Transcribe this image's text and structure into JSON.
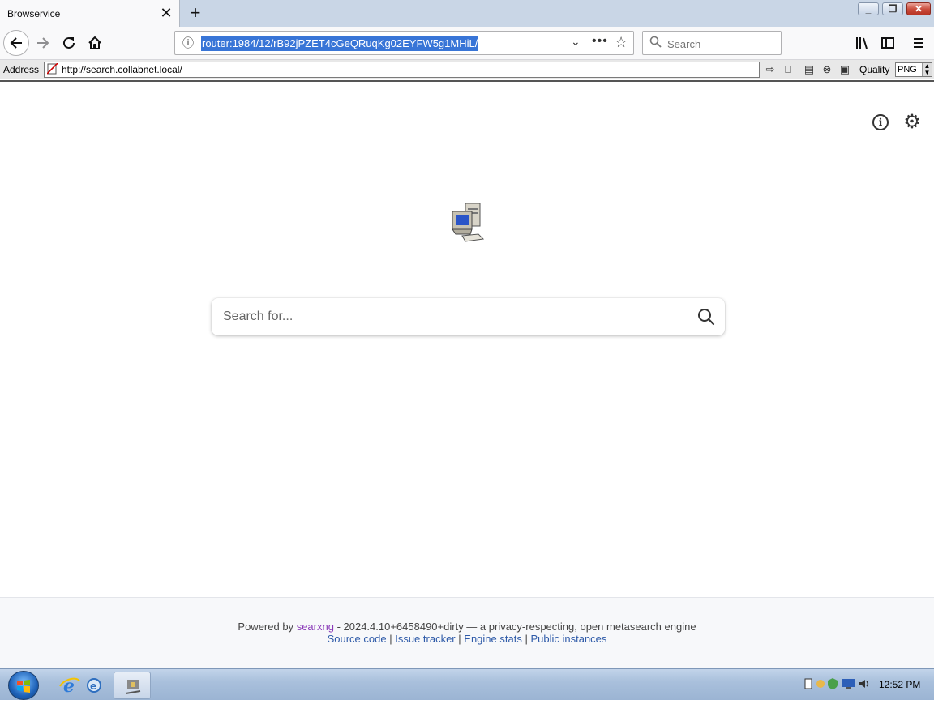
{
  "browser": {
    "tab_title": "Browservice",
    "url_selected": "router:1984/12/rB92jPZET4cGeQRuqKg02EYFW5g1MHiL/",
    "search_placeholder": "Search"
  },
  "address_bar": {
    "label": "Address",
    "url": "http://search.collabnet.local/",
    "quality_label": "Quality",
    "quality_value": "PNG"
  },
  "page": {
    "search_placeholder": "Search for...",
    "footer": {
      "powered_by": "Powered by",
      "engine_name": "searxng",
      "version_text": "- 2024.4.10+6458490+dirty — a privacy-respecting, open metasearch engine",
      "links": [
        "Source code",
        "Issue tracker",
        "Engine stats",
        "Public instances"
      ],
      "separator": "|"
    }
  },
  "taskbar": {
    "clock": "12:52 PM"
  },
  "icons": {
    "back": "arrow-left-icon",
    "forward": "arrow-right-icon",
    "reload": "reload-icon",
    "home": "home-icon",
    "info": "info-icon",
    "settings": "gear-icon",
    "search": "search-icon"
  }
}
